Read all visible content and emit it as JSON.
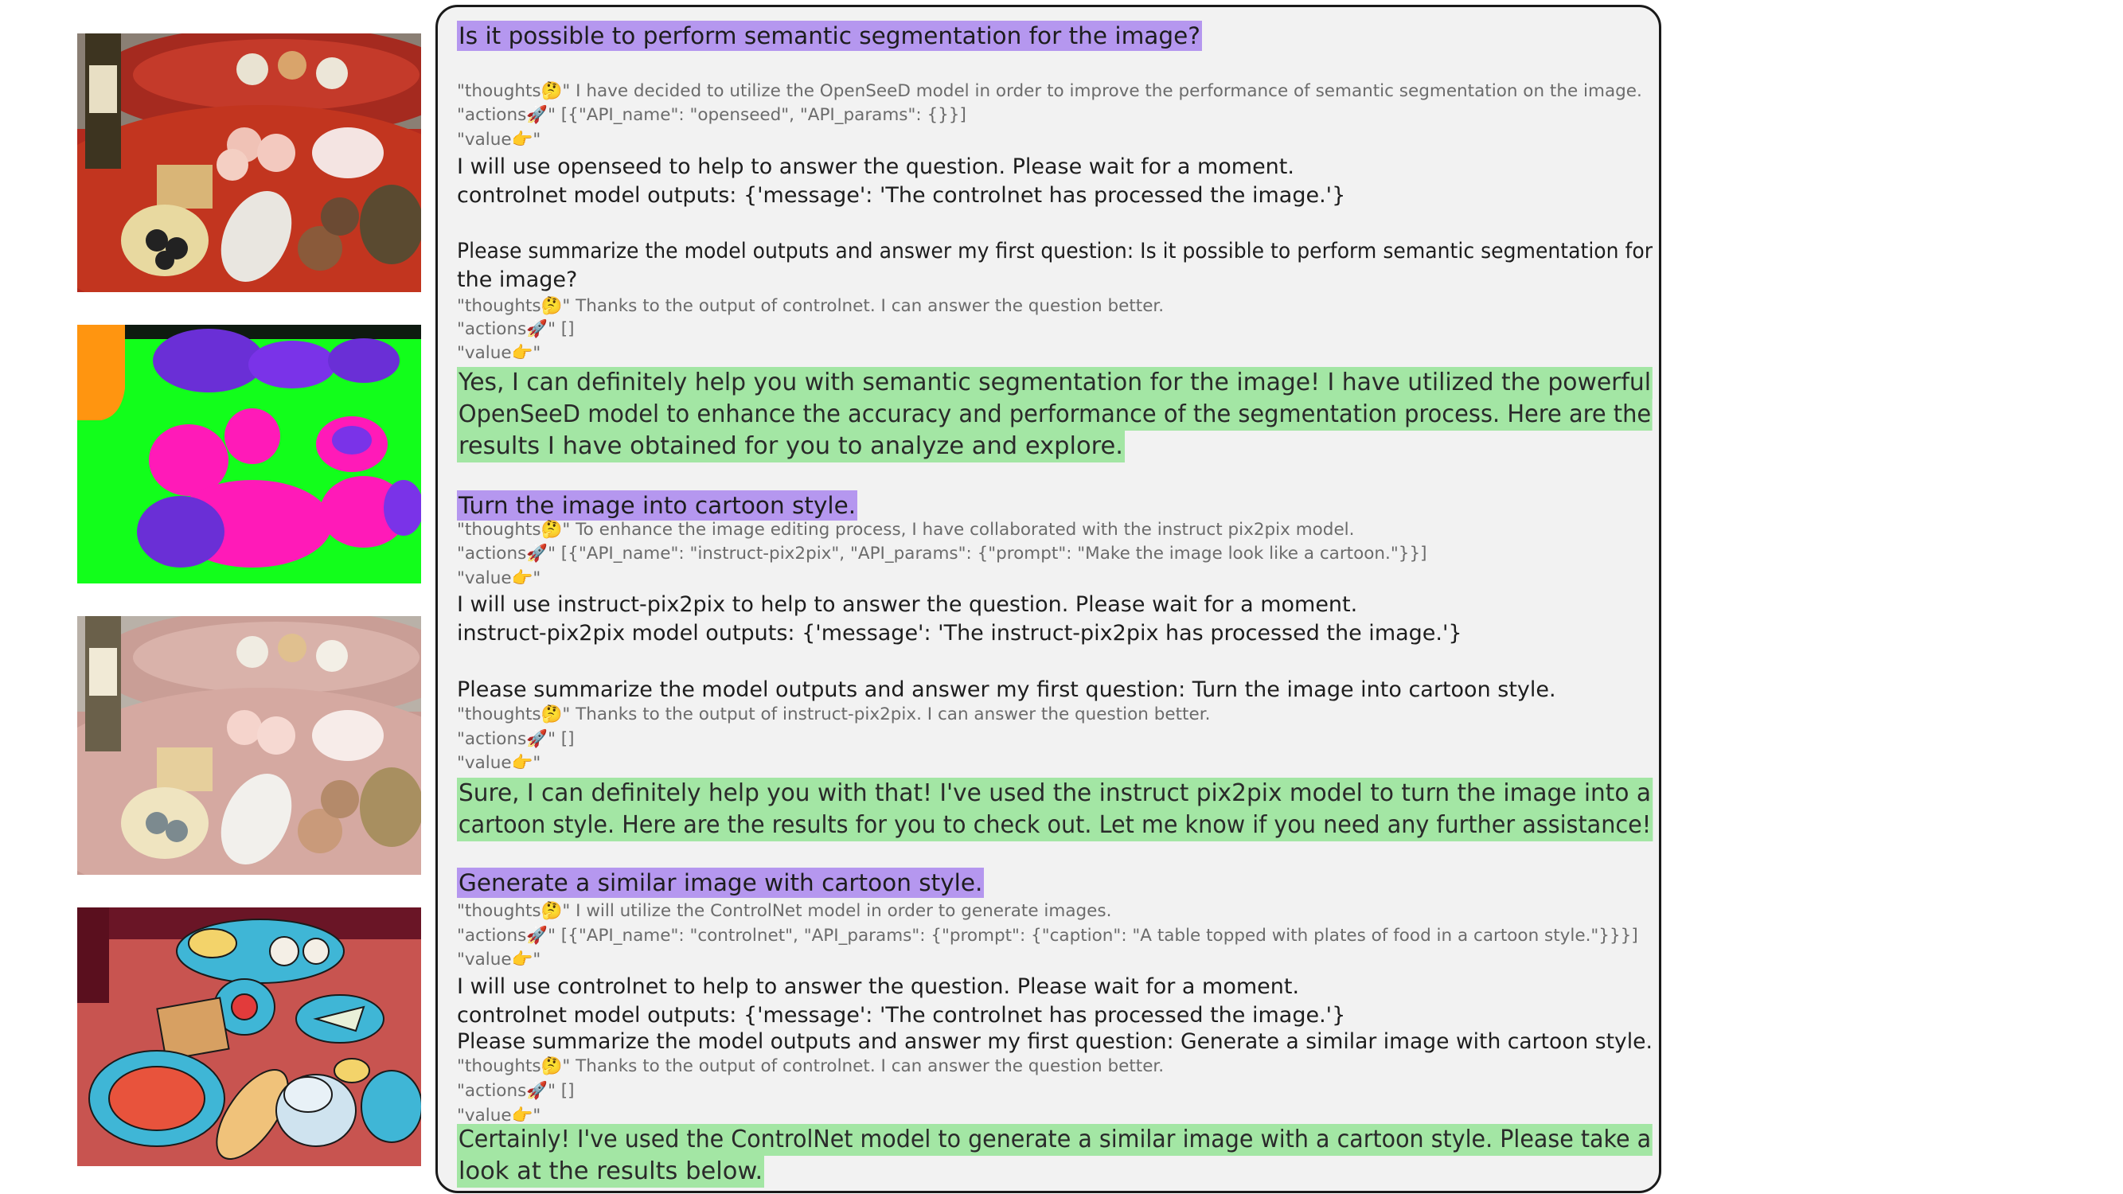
{
  "images": {
    "photo_alt": "",
    "segmentation_alt": "",
    "cartoon_photo_alt": "",
    "cartoon_generated_alt": ""
  },
  "emoji": {
    "thoughts": "🤔",
    "actions": "🚀",
    "value": "👉"
  },
  "conversation": {
    "q1": "Is it possible to perform semantic segmentation for the image?",
    "t1_label": "\"thoughts",
    "t1_text": "\" I have decided to utilize the OpenSeeD model in order to improve the performance of semantic segmentation on the image.",
    "a1_label": "\"actions",
    "a1_text": "\" [{\"API_name\": \"openseed\", \"API_params\": {}}]",
    "v1_label": "\"value",
    "v1_text": "\"",
    "b1": "I will use openseed to help to answer the question. Please wait for a moment.",
    "b2": "controlnet model outputs: {'message': 'The controlnet has processed the image.'}",
    "s1_l1": "Please summarize the model outputs and answer my first question: Is it possible to perform semantic segmentation for",
    "s1_l2": "the image?",
    "t2_text": "\" Thanks to the output of controlnet. I can answer the question better.",
    "a2_text": "\" []",
    "ans1_l1": "Yes, I can definitely help you with semantic segmentation for the image! I have utilized the powerful",
    "ans1_l2": "OpenSeeD model to enhance the accuracy and performance of the segmentation process. Here are the",
    "ans1_l3": "results I have obtained for you to analyze and explore.",
    "q2": "Turn the image into cartoon style.",
    "t3_text": "\" To enhance the image editing process, I have collaborated with the instruct pix2pix model.",
    "a3_text": "\" [{\"API_name\": \"instruct-pix2pix\", \"API_params\": {\"prompt\": \"Make the image look like a cartoon.\"}}]",
    "b3": "I will use instruct-pix2pix to help to answer the question. Please wait for a moment.",
    "b4": "instruct-pix2pix model outputs: {'message': 'The instruct-pix2pix has processed the image.'}",
    "s2": "Please summarize the model outputs and answer my first question: Turn the image into cartoon style.",
    "t4_text": "\" Thanks to the output of instruct-pix2pix. I can answer the question better.",
    "ans2_l1": "Sure, I can definitely help you with that! I've used the instruct pix2pix model to turn the image into a",
    "ans2_l2": "cartoon style. Here are the results for you to check out. Let me know if you need any further assistance!",
    "q3": "Generate a similar image with cartoon style.",
    "t5_text": "\" I will utilize the ControlNet model in order to generate images.",
    "a5_text": "\" [{\"API_name\": \"controlnet\", \"API_params\": {\"prompt\": {\"caption\": \"A table topped with plates of food in a cartoon style.\"}}}]",
    "b5": "I will use controlnet to help to answer the question. Please wait for a moment.",
    "b6": "controlnet model outputs: {'message': 'The controlnet has processed the image.'}",
    "s3": "Please summarize the model outputs and answer my first question: Generate a similar image with cartoon style.",
    "t6_text": "\" Thanks to the output of controlnet. I can answer the question better.",
    "ans3_l1": "Certainly! I've used the ControlNet model to generate a similar image with a cartoon style. Please take a",
    "ans3_l2": "look at the results below."
  }
}
